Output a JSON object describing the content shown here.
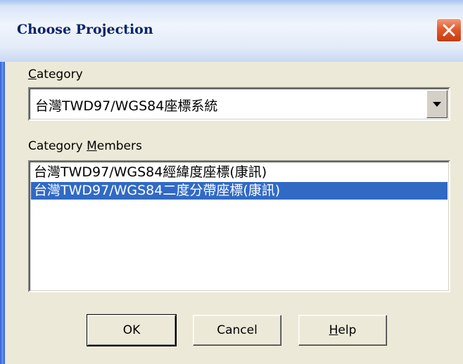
{
  "dialog": {
    "title": "Choose Projection"
  },
  "category": {
    "label_prefix": "",
    "label_mnemonic": "C",
    "label_rest": "ategory",
    "value": "台灣TWD97/WGS84座標系統"
  },
  "members": {
    "label_prefix": "Category ",
    "label_mnemonic": "M",
    "label_rest": "embers",
    "items": [
      {
        "label": "台灣TWD97/WGS84經緯度座標(康訊)",
        "selected": false
      },
      {
        "label": "台灣TWD97/WGS84二度分帶座標(康訊)",
        "selected": true
      }
    ]
  },
  "buttons": {
    "ok": "OK",
    "cancel": "Cancel",
    "help_mnemonic": "H",
    "help_rest": "elp"
  },
  "colors": {
    "selection": "#316ac5",
    "title_text": "#0a246a",
    "close_button": "#e25a2c"
  }
}
